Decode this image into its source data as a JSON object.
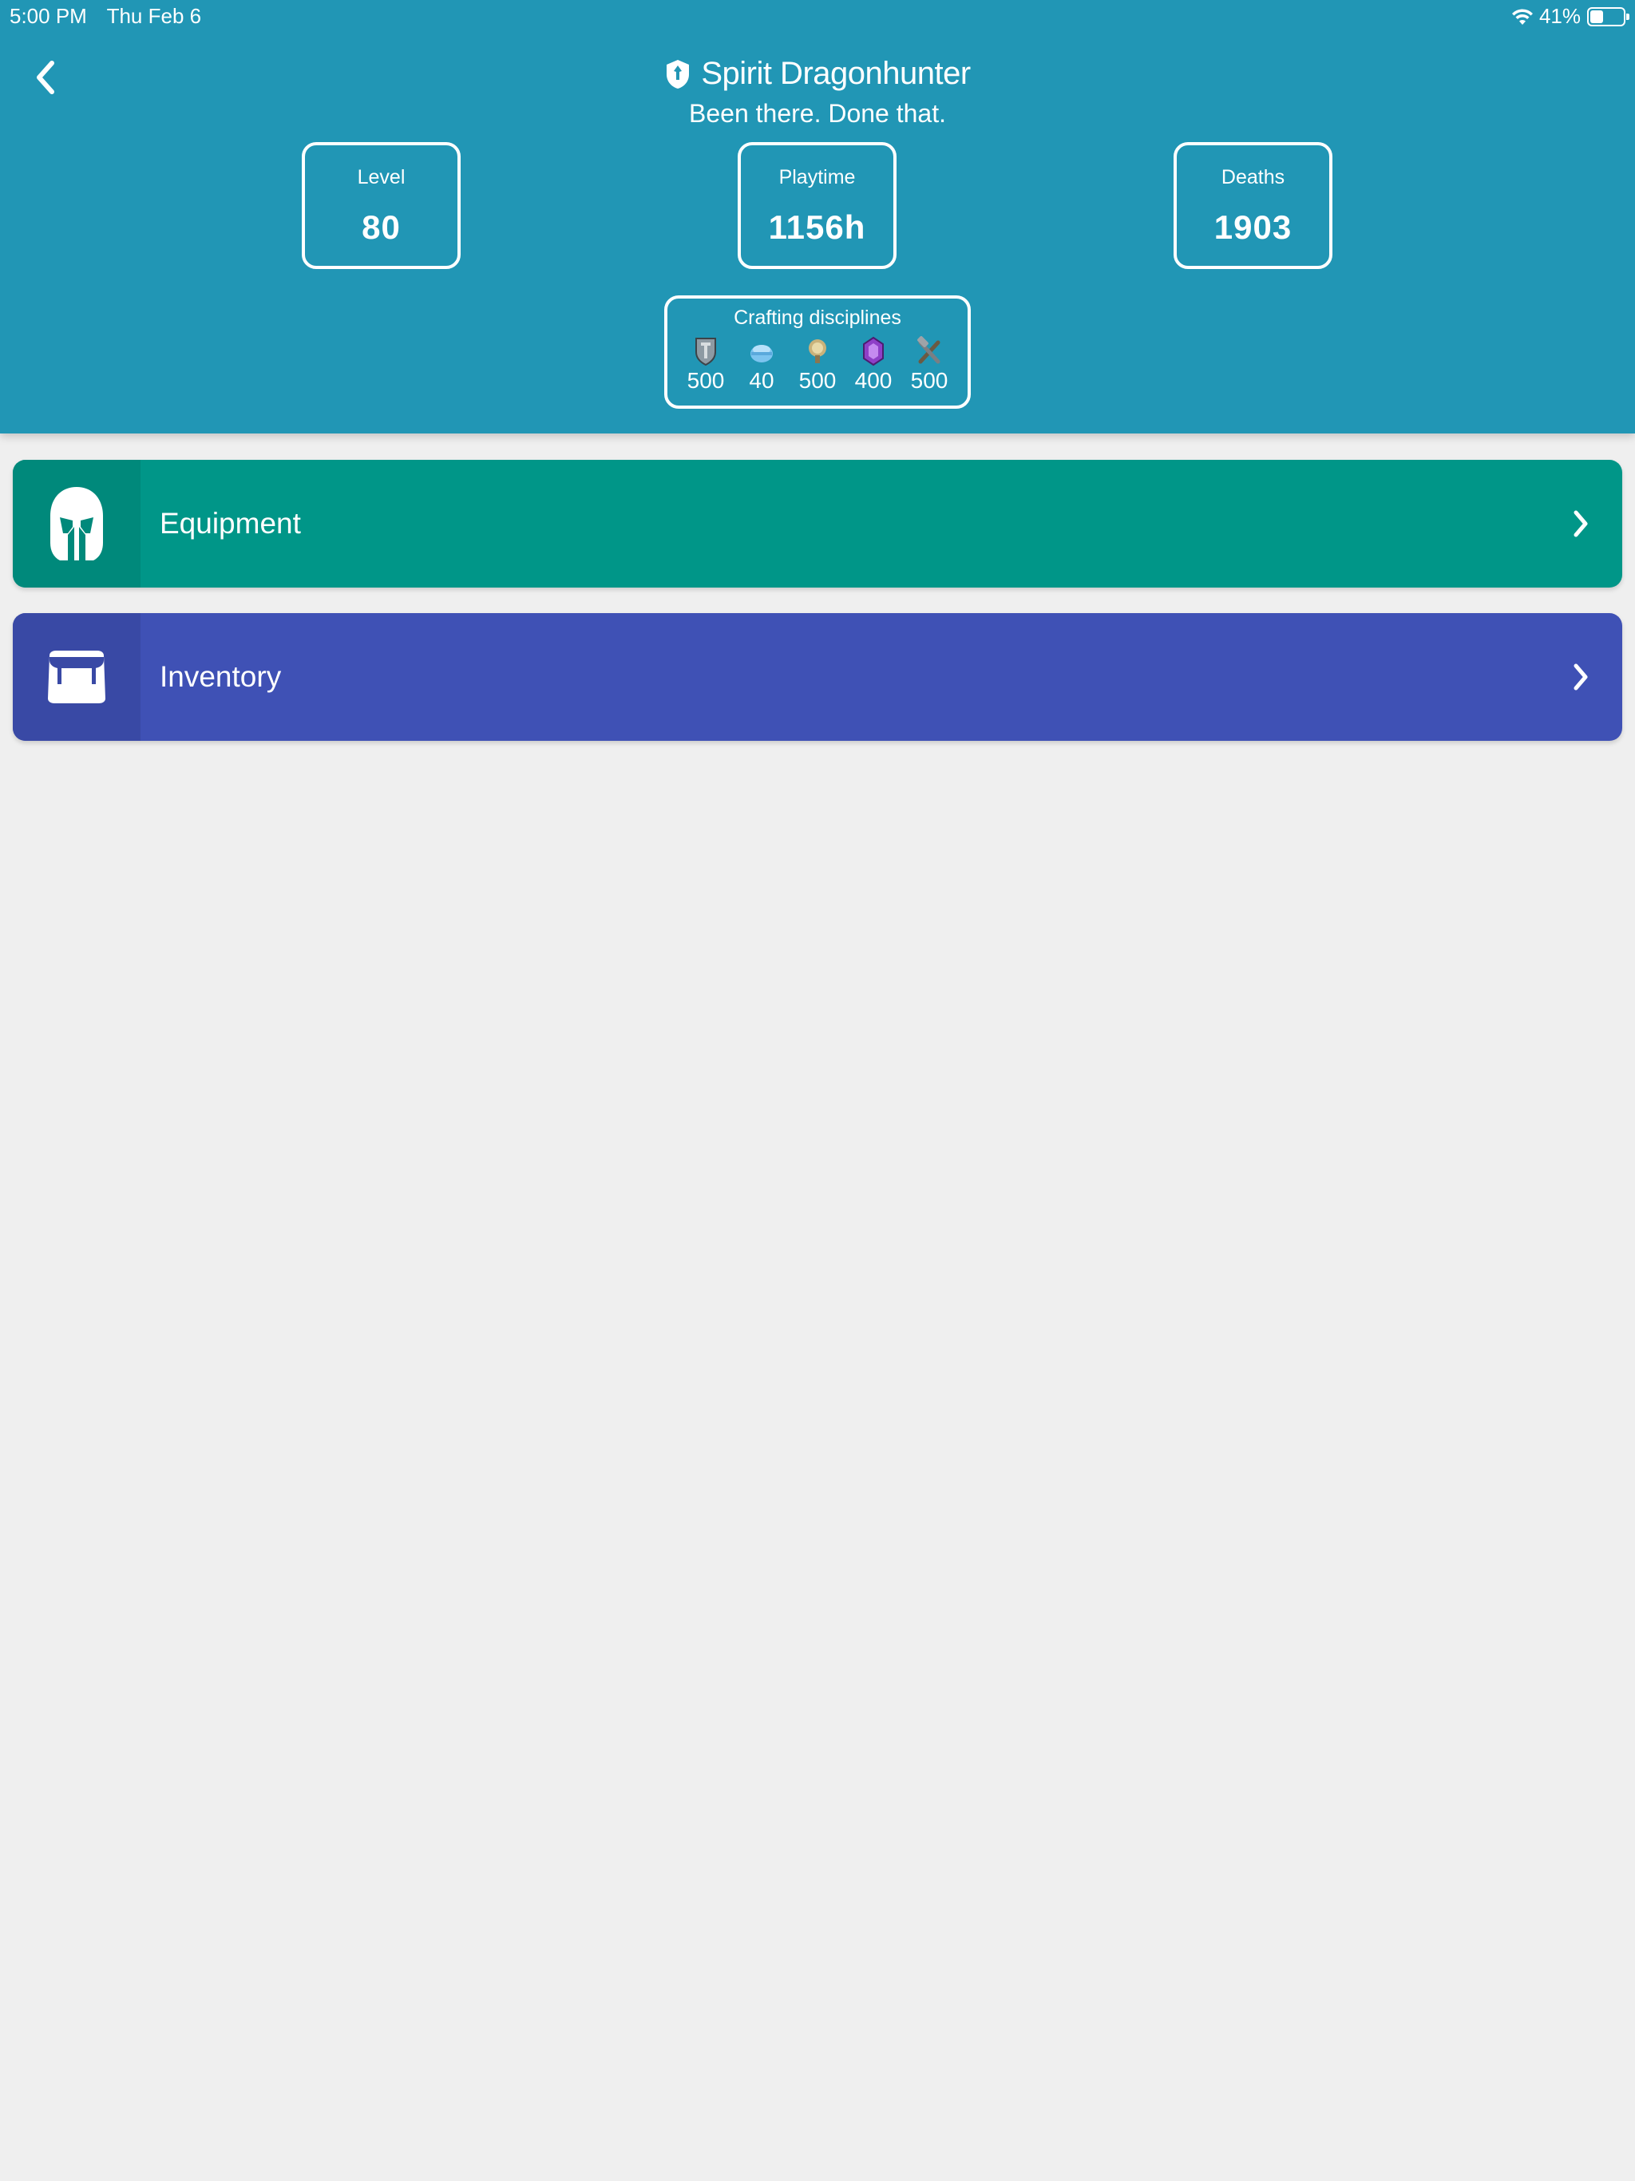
{
  "status_bar": {
    "time": "5:00 PM",
    "date": "Thu Feb 6",
    "battery_percent_text": "41%",
    "battery_level": 0.41
  },
  "header": {
    "back_icon": "chevron-left-icon",
    "profession_icon": "dragonhunter-icon",
    "character_name": "Spirit Dragonhunter",
    "subtitle": "Been there. Done that.",
    "background_color": "#2196b5"
  },
  "stats": {
    "level": {
      "label": "Level",
      "value": "80"
    },
    "playtime": {
      "label": "Playtime",
      "value": "1156h"
    },
    "deaths": {
      "label": "Deaths",
      "value": "1903"
    }
  },
  "crafting": {
    "title": "Crafting disciplines",
    "disciplines": [
      {
        "icon": "armorsmith-icon",
        "value": "500"
      },
      {
        "icon": "chef-icon",
        "value": "40"
      },
      {
        "icon": "huntsman-icon",
        "value": "500"
      },
      {
        "icon": "jeweler-icon",
        "value": "400"
      },
      {
        "icon": "weaponsmith-icon",
        "value": "500"
      }
    ]
  },
  "nav": {
    "equipment": {
      "label": "Equipment",
      "icon": "helmet-icon",
      "color": "#009688"
    },
    "inventory": {
      "label": "Inventory",
      "icon": "bag-icon",
      "color": "#3f51b5"
    }
  }
}
